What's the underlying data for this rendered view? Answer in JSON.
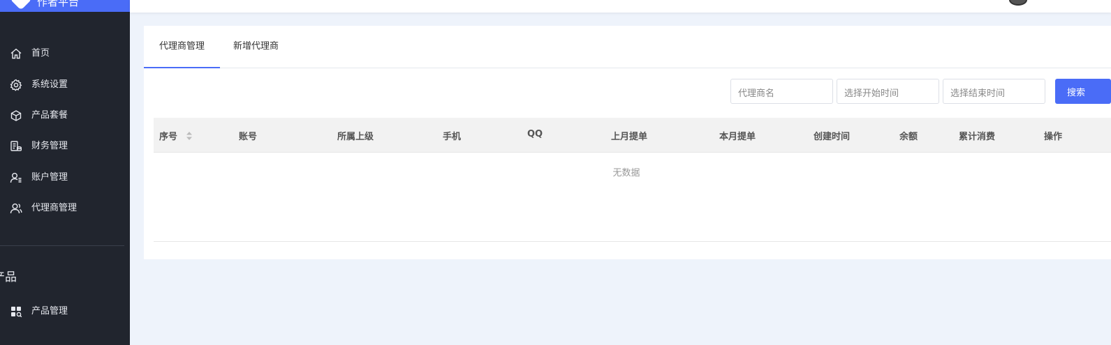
{
  "app": {
    "logo_text": "作者平台"
  },
  "sidebar": {
    "items": [
      {
        "label": "首页",
        "icon": "home-icon"
      },
      {
        "label": "系统设置",
        "icon": "gear-icon"
      },
      {
        "label": "产品套餐",
        "icon": "package-icon"
      },
      {
        "label": "财务管理",
        "icon": "finance-icon"
      },
      {
        "label": "账户管理",
        "icon": "user-settings-icon"
      },
      {
        "label": "代理商管理",
        "icon": "agent-icon"
      }
    ],
    "section_title": "产品",
    "section_items": [
      {
        "label": "产品管理",
        "icon": "product-grid-icon"
      }
    ]
  },
  "tabs": [
    {
      "label": "代理商管理",
      "active": true
    },
    {
      "label": "新增代理商",
      "active": false
    }
  ],
  "filters": {
    "agent_name_placeholder": "代理商名",
    "start_time_placeholder": "选择开始时间",
    "end_time_placeholder": "选择结束时间",
    "search_label": "搜索"
  },
  "table": {
    "columns": [
      "序号",
      "账号",
      "所属上级",
      "手机",
      "QQ",
      "上月提单",
      "本月提单",
      "创建时间",
      "余额",
      "累计消费",
      "操作"
    ],
    "rows": [],
    "empty_text": "无数据"
  },
  "colors": {
    "accent": "#4a6cf7",
    "sidebar_bg": "#21252e",
    "page_bg": "#eef3fb"
  }
}
